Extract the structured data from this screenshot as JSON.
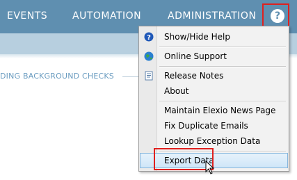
{
  "nav": {
    "items": [
      "EVENTS",
      "AUTOMATION",
      "ADMINISTRATION"
    ],
    "help_symbol": "?",
    "help_icon": "question-circle-icon",
    "accent": "#5f8fb0",
    "highlight_border": "#e0201e"
  },
  "section": {
    "heading": "DING BACKGROUND CHECKS"
  },
  "menu": {
    "items": [
      {
        "label": "Show/Hide Help",
        "icon": "help-icon"
      },
      {
        "label": "Online Support",
        "icon": "globe-icon"
      },
      {
        "label": "Release Notes",
        "icon": "document-icon"
      },
      {
        "label": "About"
      },
      {
        "label": "Maintain Elexio News Page"
      },
      {
        "label": "Fix Duplicate Emails"
      },
      {
        "label": "Lookup Exception Data"
      },
      {
        "label": "Export Data",
        "highlighted": true
      }
    ]
  }
}
